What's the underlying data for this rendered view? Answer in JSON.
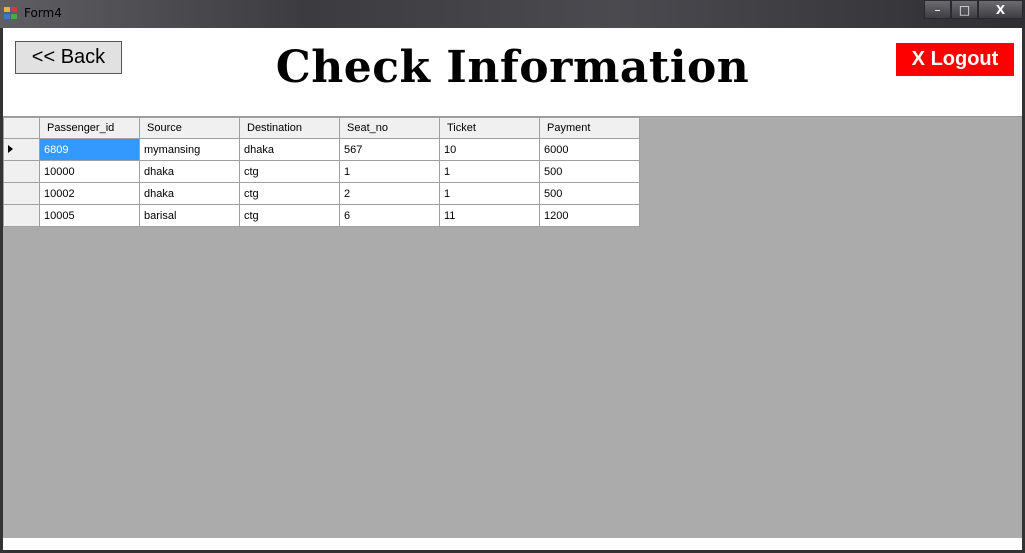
{
  "window": {
    "title": "Form4",
    "minimize_label": "–",
    "maximize_label": "□",
    "close_label": "X"
  },
  "header": {
    "back_label": "<< Back",
    "title": "Check Information",
    "logout_label": "X Logout"
  },
  "colors": {
    "logout_bg": "#ff0000",
    "selection": "#3399ff",
    "grid_background": "#ababab"
  },
  "grid": {
    "columns": [
      "Passenger_id",
      "Source",
      "Destination",
      "Seat_no",
      "Ticket",
      "Payment"
    ],
    "rows": [
      [
        "6809",
        "mymansing",
        "dhaka",
        "567",
        "10",
        "6000"
      ],
      [
        "10000",
        "dhaka",
        "ctg",
        "1",
        "1",
        "500"
      ],
      [
        "10002",
        "dhaka",
        "ctg",
        "2",
        "1",
        "500"
      ],
      [
        "10005",
        "barisal",
        "ctg",
        "6",
        "11",
        "1200"
      ]
    ]
  }
}
